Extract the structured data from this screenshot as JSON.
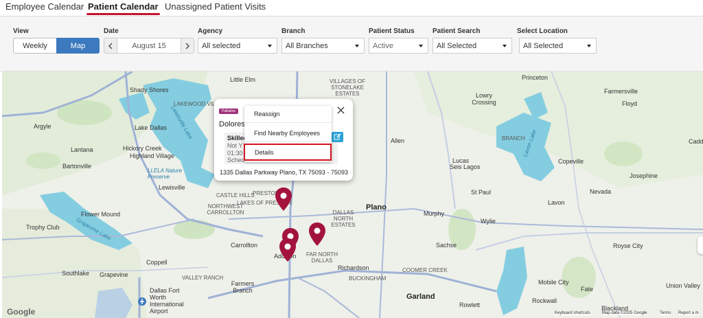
{
  "tabs": [
    {
      "label": "Employee Calendar",
      "active": false
    },
    {
      "label": "Patient Calendar",
      "active": true
    },
    {
      "label": "Unassigned Patient Visits",
      "active": false
    }
  ],
  "filters": {
    "view": {
      "label": "View",
      "options": [
        "Weekly",
        "Map"
      ],
      "selected": "Map"
    },
    "date": {
      "label": "Date",
      "value": "August 15"
    },
    "agency": {
      "label": "Agency",
      "value": "All selected"
    },
    "branch": {
      "label": "Branch",
      "value": "All Branches"
    },
    "patient_status": {
      "label": "Patient Status",
      "value": "Active"
    },
    "patient_search": {
      "label": "Patient Search",
      "value": "All Selected"
    },
    "select_location": {
      "label": "Select Location",
      "value": "All Selected"
    }
  },
  "colors": {
    "accent": "#3c79be",
    "tab_underline": "#c8102e",
    "pin": "#a3143c",
    "badge": "#a0337b",
    "menu_highlight": "#d1121f"
  },
  "popup": {
    "badge": "Palliative",
    "patient_name": "Dolores",
    "visit_type": "Skilled",
    "visit_status": "Not Y",
    "visit_time": "01:30",
    "visit_sched": "Sched",
    "address": "1335 Dallas Parkway Plano, TX 75093 - 75093",
    "close_icon": "close-icon",
    "edit_icon": "edit-icon"
  },
  "context_menu": {
    "items": [
      "Reassign",
      "Find Nearby Employees",
      "Details"
    ],
    "highlighted": "Details"
  },
  "map": {
    "labels": {
      "little_elm": "Little Elm",
      "shady_shores": "Shady Shores",
      "lakewood_village": "LAKEWOOD VILLAGE",
      "argyle": "Argyle",
      "lake_dallas": "Lake Dallas",
      "lantana": "Lantana",
      "hickory_creek": "Hickory Creek",
      "highland_village": "Highland Village",
      "bartonville": "Bartonville",
      "llela": "LLELA Nature Preserve",
      "lewisville_lake": "Lewisville Lake",
      "lewisville": "Lewisville",
      "flower_mound": "Flower Mound",
      "trophy_club": "Trophy Club",
      "grapevine_lake": "Grapevine Lake",
      "castle_hills": "CASTLE HILLS",
      "northwest_carrollton": "NORTHWEST CARROLLTON",
      "preston": "PRESTON",
      "carrollton": "Carrollton",
      "coppell": "Coppell",
      "southlake": "Southlake",
      "grapevine": "Grapevine",
      "valley_ranch": "VALLEY RANCH",
      "farmers_branch": "Farmers Branch",
      "dfw_airport": "Dallas Fort Worth International Airport",
      "addison": "Addison",
      "far_north_dallas": "FAR NORTH DALLAS",
      "richardson": "Richardson",
      "buckingham": "BUCKINGHAM",
      "plano": "Plano",
      "dallas_north_estates": "DALLAS NORTH ESTATES",
      "villages_stonelake": "VILLAGES OF STONELAKE ESTATES",
      "lowry_crossing": "Lowry Crossing",
      "princeton": "Princeton",
      "farmersville": "Farmersville",
      "floyd": "Floyd",
      "allen": "Allen",
      "branch": "BRANCH",
      "lavon_lake": "Lavon Lake",
      "copeville": "Copeville",
      "lucas": "Lucas",
      "st_paul": "St Paul",
      "murphy": "Murphy",
      "wylie": "Wylie",
      "sachse": "Sachse",
      "nevada": "Nevada",
      "lavon": "Lavon",
      "josephine": "Josephine",
      "royse_city": "Royse City",
      "coomer_creek": "COOMER CREEK",
      "garland": "Garland",
      "rowlett": "Rowlett",
      "rockwall": "Rockwall",
      "fate": "Fate",
      "mobile_city": "Mobile City",
      "union_valley": "Union Valley",
      "blackland": "Blackland",
      "lakes_of_preston": "LAKES OF PRESTON",
      "seis_lagos": "Seis Lagos",
      "caddo_mills": "Caddo",
      "dallas_north": "DALLAS NORTH",
      "buckingham2": "BUCKINGHAM"
    },
    "google_logo": "Google",
    "attribution": [
      "Keyboard shortcuts",
      "Map data ©2025 Google",
      "Terms",
      "Report a m"
    ]
  }
}
